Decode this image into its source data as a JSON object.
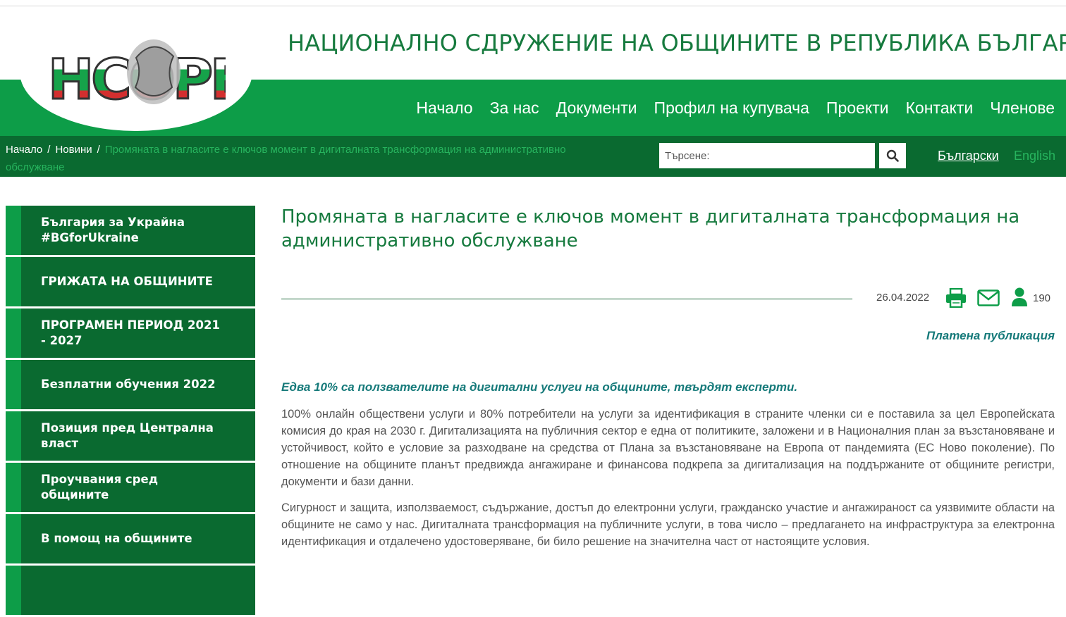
{
  "header": {
    "title": "НАЦИОНАЛНО СДРУЖЕНИЕ НА ОБЩИНИТЕ В РЕПУБЛИКА БЪЛГАРИЯ",
    "logo_text": "НСОРБ",
    "nav": [
      "Начало",
      "За нас",
      "Документи",
      "Профил на купувача",
      "Проекти",
      "Контакти",
      "Членове"
    ]
  },
  "breadcrumb": {
    "home": "Начало",
    "news": "Новини",
    "current": "Промяната в нагласите е ключов момент в дигиталната трансформация на административно обслужване"
  },
  "search": {
    "placeholder": "Търсене:",
    "icon": "search-icon"
  },
  "languages": {
    "bg": "Български",
    "en": "English"
  },
  "sidebar": {
    "items": [
      "България за Украйна #BGforUkraine",
      "ГРИЖАТА НА ОБЩИНИТЕ",
      "ПРОГРАМЕН ПЕРИОД 2021 - 2027",
      "Безплатни обучения 2022",
      "Позиция пред Централна власт",
      "Проучвания сред общините",
      "В помощ на общините"
    ]
  },
  "article": {
    "title": "Промяната в нагласите е ключов момент в дигиталната трансформация на административно обслужване",
    "date": "26.04.2022",
    "views": "190",
    "paid_label": "Платена публикация",
    "lead": "Едва 10% са ползвателите на дигитални услуги на общините, твърдят експерти.",
    "paragraphs": [
      "100% онлайн обществени услуги и 80% потребители на услуги за идентификация в страните членки си е поставила за цел Европейската комисия до края на 2030 г. Дигитализацията на публичния сектор е една от политиките, заложени и в Националния план за възстановяване и устойчивост, който е условие за разходване на средства от Плана за възстановяване на Европа от пандемията (ЕС Ново поколение). По отношение на общините планът предвижда ангажиране и финансова подкрепа за дигитализация на поддържаните от общините регистри, документи и бази данни.",
      "Сигурност и защита, използваемост, съдържание, достъп до електронни услуги, гражданско участие и ангажираност са уязвимите области на общините не само у нас. Дигиталната трансформация на публичните услуги, в това число – предлагането на инфраструктура за електронна идентификация и отдалечено удостоверяване, би било решение на значителна част от настоящите условия."
    ]
  },
  "colors": {
    "green": "#0d9d48",
    "dark_green": "#0a6a30",
    "title_green": "#167a3e",
    "teal": "#167a7a"
  }
}
